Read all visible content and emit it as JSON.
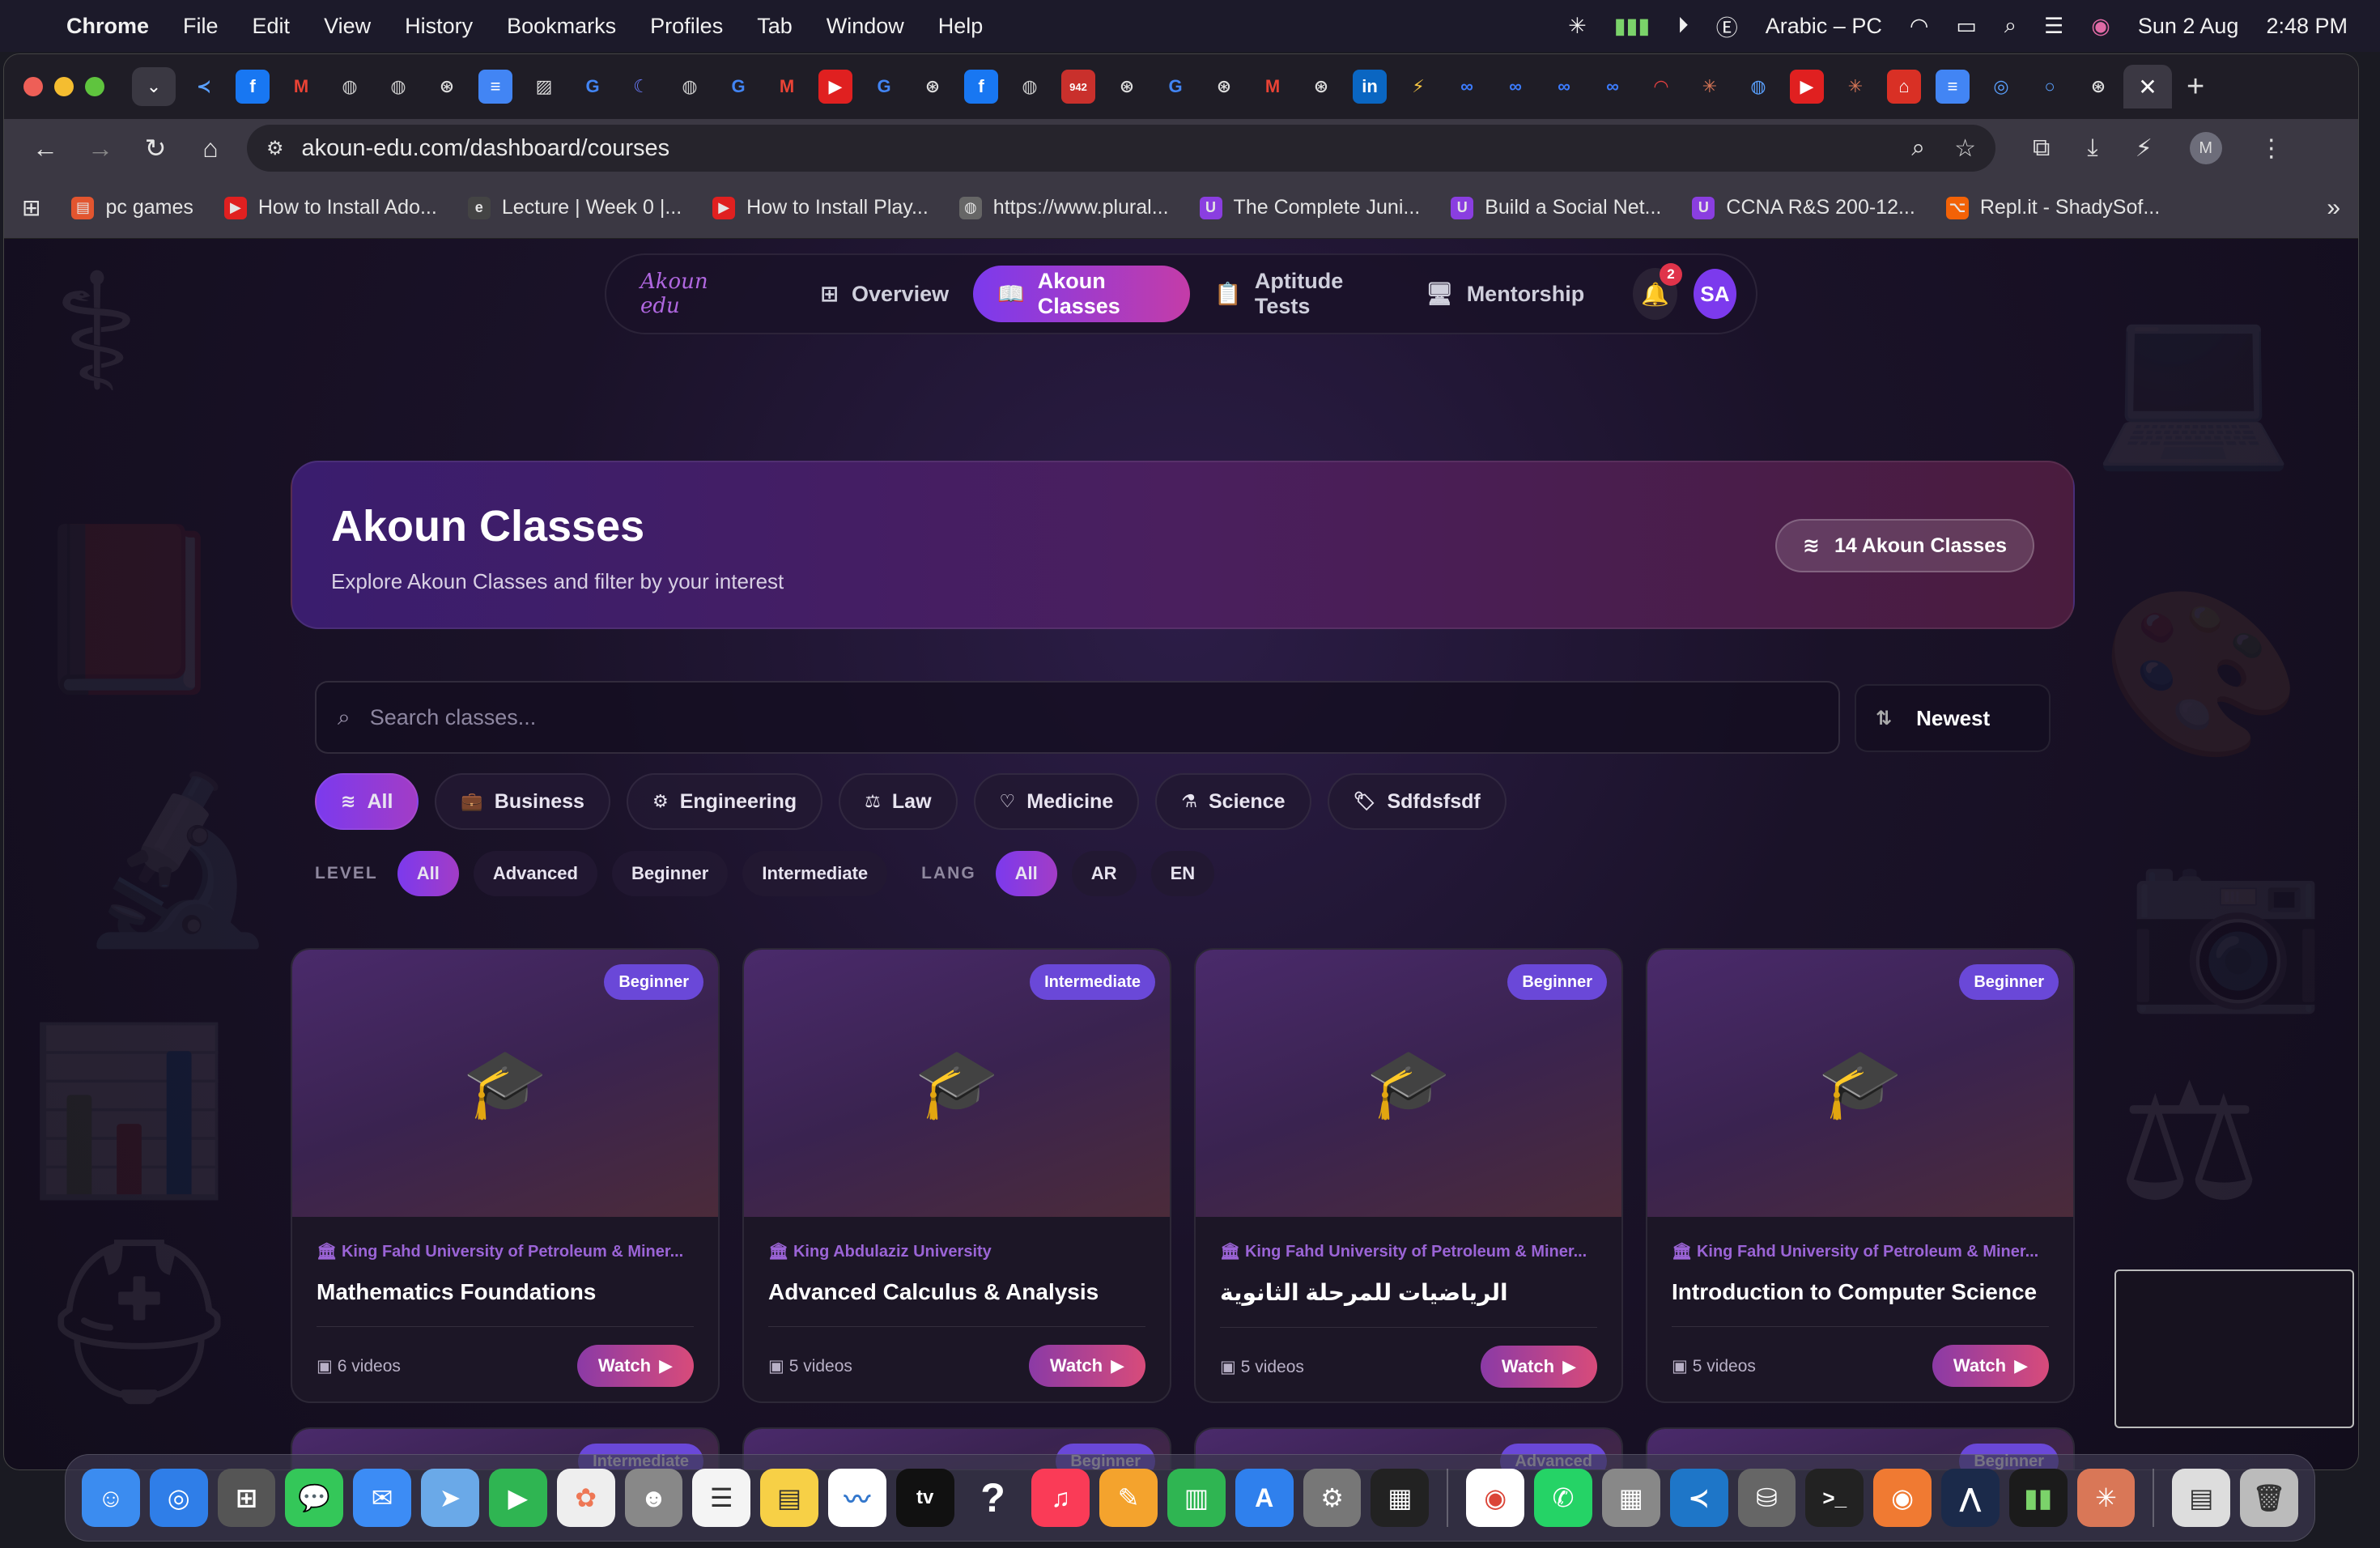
{
  "menubar": {
    "app": "Chrome",
    "items": [
      "File",
      "Edit",
      "View",
      "History",
      "Bookmarks",
      "Profiles",
      "Tab",
      "Window",
      "Help"
    ],
    "input_source": "Arabic – PC",
    "date": "Sun 2 Aug",
    "time": "2:48 PM"
  },
  "browser": {
    "url": "akoun-edu.com/dashboard/courses",
    "profile_initial": "M",
    "bookmarks": [
      {
        "label": "pc games",
        "icon_color": "#e2552f",
        "icon": "▤"
      },
      {
        "label": "How to Install Ado...",
        "icon_color": "#e02020",
        "icon": "▶"
      },
      {
        "label": "Lecture | Week 0 |...",
        "icon_color": "#444444",
        "icon": "e"
      },
      {
        "label": "How to Install Play...",
        "icon_color": "#e02020",
        "icon": "▶"
      },
      {
        "label": "https://www.plural...",
        "icon_color": "#666666",
        "icon": "◍"
      },
      {
        "label": "The Complete Juni...",
        "icon_color": "#8a3ee0",
        "icon": "U"
      },
      {
        "label": "Build a Social Net...",
        "icon_color": "#8a3ee0",
        "icon": "U"
      },
      {
        "label": "CCNA R&S 200-12...",
        "icon_color": "#8a3ee0",
        "icon": "U"
      },
      {
        "label": "Repl.it - ShadySof...",
        "icon_color": "#f26207",
        "icon": "⌥"
      }
    ],
    "tab_badge": "942"
  },
  "nav": {
    "logo": "Akoun edu",
    "items": [
      {
        "label": "Overview",
        "icon": "⊞"
      },
      {
        "label": "Akoun Classes",
        "icon": "📖"
      },
      {
        "label": "Aptitude Tests",
        "icon": "📋"
      },
      {
        "label": "Mentorship",
        "icon": "🖥"
      }
    ],
    "notifications": "2",
    "avatar": "SA"
  },
  "hero": {
    "title": "Akoun Classes",
    "subtitle": "Explore Akoun Classes and filter by your interest",
    "count_badge": "14 Akoun Classes"
  },
  "search": {
    "placeholder": "Search classes...",
    "sort": "Newest"
  },
  "categories": [
    {
      "label": "All",
      "icon": "≋"
    },
    {
      "label": "Business",
      "icon": "💼"
    },
    {
      "label": "Engineering",
      "icon": "⚙"
    },
    {
      "label": "Law",
      "icon": "⚖"
    },
    {
      "label": "Medicine",
      "icon": "♡"
    },
    {
      "label": "Science",
      "icon": "⚗"
    },
    {
      "label": "Sdfdsfsdf",
      "icon": "🏷"
    }
  ],
  "filters": {
    "level_label": "LEVEL",
    "levels": [
      "All",
      "Advanced",
      "Beginner",
      "Intermediate"
    ],
    "lang_label": "LANG",
    "langs": [
      "All",
      "AR",
      "EN"
    ]
  },
  "courses": [
    {
      "level": "Beginner",
      "university": "King Fahd University of Petroleum & Miner...",
      "title": "Mathematics Foundations",
      "videos": "6 videos",
      "action": "Watch"
    },
    {
      "level": "Intermediate",
      "university": "King Abdulaziz University",
      "title": "Advanced Calculus & Analysis",
      "videos": "5 videos",
      "action": "Watch"
    },
    {
      "level": "Beginner",
      "university": "King Fahd University of Petroleum & Miner...",
      "title": "الرياضيات للمرحلة الثانوية",
      "videos": "5 videos",
      "action": "Watch"
    },
    {
      "level": "Beginner",
      "university": "King Fahd University of Petroleum & Miner...",
      "title": "Introduction to Computer Science",
      "videos": "5 videos",
      "action": "Watch"
    },
    {
      "level": "Intermediate"
    },
    {
      "level": "Beginner"
    },
    {
      "level": "Advanced"
    },
    {
      "level": "Beginner"
    }
  ],
  "colors": {
    "accent": "#7c3aed",
    "watch_gradient_end": "#d84b7a",
    "level_badge": "#6a48d8"
  }
}
